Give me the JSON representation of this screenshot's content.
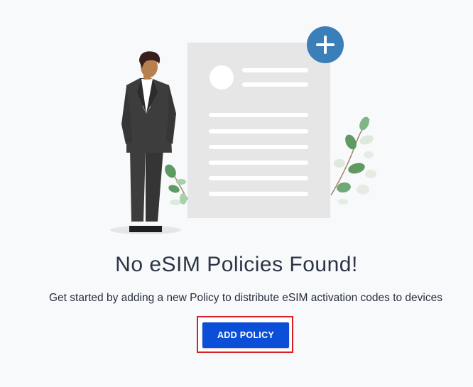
{
  "empty_state": {
    "title": "No eSIM Policies Found!",
    "description": "Get started by adding a new Policy to distribute eSIM activation codes to devices",
    "button_label": "ADD POLICY"
  },
  "colors": {
    "background": "#f8f9fb",
    "primary_button": "#0b4ed8",
    "highlight_border": "#d81f26",
    "plus_badge": "#3b7fb9",
    "document": "#e6e6e6",
    "suit": "#3d3d3d",
    "leaf_dark": "#5f9a63",
    "leaf_light": "#a8d1aa"
  },
  "icons": {
    "badge": "plus-icon"
  }
}
